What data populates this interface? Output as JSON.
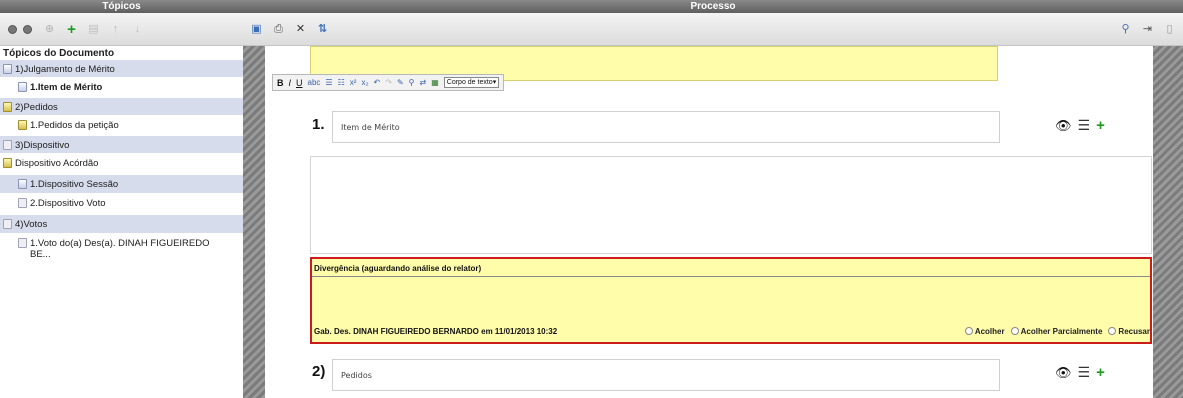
{
  "left_panel": {
    "header": "Tópicos",
    "tree_title": "Tópicos do Documento",
    "nodes": [
      {
        "label": "1)Julgamento de Mérito",
        "bold": false,
        "indent": 0,
        "hl": true,
        "ic": "blue"
      },
      {
        "label": "1.Item de Mérito",
        "bold": true,
        "indent": 1,
        "hl": false,
        "ic": "blue"
      },
      {
        "label": "2)Pedidos",
        "bold": false,
        "indent": 0,
        "hl": true,
        "ic": "yellow"
      },
      {
        "label": "1.Pedidos da petição",
        "bold": false,
        "indent": 1,
        "hl": false,
        "ic": "yellow"
      },
      {
        "label": "3)Dispositivo",
        "bold": false,
        "indent": 0,
        "hl": true,
        "ic": "plain"
      },
      {
        "label": "Dispositivo Acórdão",
        "bold": false,
        "indent": 0,
        "hl": false,
        "ic": "yellow"
      },
      {
        "label": "1.Dispositivo Sessão",
        "bold": false,
        "indent": 1,
        "hl": true,
        "ic": "blue"
      },
      {
        "label": "2.Dispositivo Voto",
        "bold": false,
        "indent": 1,
        "hl": false,
        "ic": "plain"
      },
      {
        "label": "4)Votos",
        "bold": false,
        "indent": 0,
        "hl": true,
        "ic": "plain"
      },
      {
        "label": "1.Voto do(a) Des(a). DINAH FIGUEIREDO BE...",
        "bold": false,
        "indent": 1,
        "hl": false,
        "ic": "plain"
      }
    ]
  },
  "right_panel": {
    "header": "Processo",
    "format_bar": {
      "bold": "B",
      "italic": "I",
      "underline": "U",
      "style_select": "Corpo de texto"
    },
    "items": [
      {
        "number": "1.",
        "text": "Item de Mérito"
      },
      {
        "number": "2)",
        "text": "Pedidos"
      }
    ],
    "divergence": {
      "title": "Divergência (aguardando análise do relator)",
      "author": "Gab. Des. DINAH FIGUEIREDO BERNARDO em 11/01/2013 10:32",
      "options": [
        "Acolher",
        "Acolher Parcialmente",
        "Recusar"
      ]
    }
  },
  "colors": {
    "header": "#6e6e6e",
    "tree_highlight": "#d6dcec",
    "yellow": "#fffcaa",
    "divergence_border": "#cc1b1b",
    "green_plus": "#1f9a1f"
  }
}
